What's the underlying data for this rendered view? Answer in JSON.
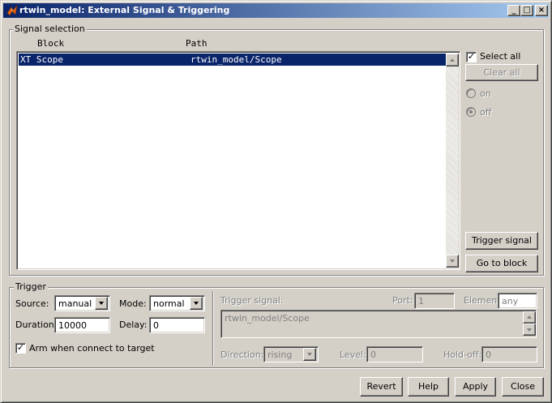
{
  "window": {
    "title": "rtwin_model: External Signal & Triggering",
    "icon": "matlab-icon",
    "controls": {
      "minimize": "_",
      "maximize": "□",
      "close": "×"
    }
  },
  "signal_selection": {
    "group_label": "Signal selection",
    "columns": [
      "Block",
      "Path"
    ],
    "rows": [
      {
        "block": "XT Scope",
        "path": "rtwin_model/Scope",
        "selected": true
      }
    ],
    "select_all_label": "Select all",
    "select_all_checked": true,
    "clear_all_label": "Clear all",
    "on_label": "on",
    "off_label": "off",
    "trigger_signal_label": "Trigger signal",
    "go_to_block_label": "Go to block"
  },
  "trigger": {
    "group_label": "Trigger",
    "source_label": "Source:",
    "source_value": "manual",
    "mode_label": "Mode:",
    "mode_value": "normal",
    "duration_label": "Duration:",
    "duration_value": "10000",
    "delay_label": "Delay:",
    "delay_value": "0",
    "arm_label": "Arm when connect to target",
    "arm_checked": true,
    "trigger_signal_label": "Trigger signal:",
    "port_label": "Port:",
    "port_value": "1",
    "element_label": "Element:",
    "element_value": "any",
    "signal_path": "rtwin_model/Scope",
    "direction_label": "Direction:",
    "direction_value": "rising",
    "level_label": "Level:",
    "level_value": "0",
    "holdoff_label": "Hold-off:",
    "holdoff_value": "0"
  },
  "footer": {
    "revert": "Revert",
    "help": "Help",
    "apply": "Apply",
    "close": "Close"
  },
  "colors": {
    "face": "#d4d0c8",
    "selection": "#0a246a",
    "title_start": "#0a246a",
    "title_end": "#a6caf0"
  }
}
